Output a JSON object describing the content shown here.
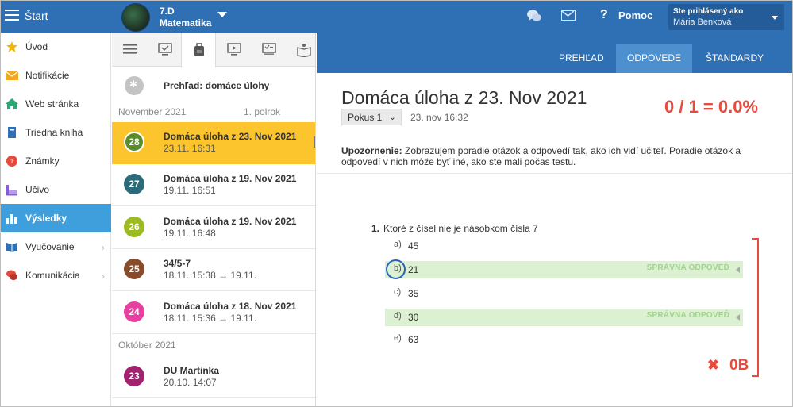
{
  "topbar": {
    "start_label": "Štart",
    "class_name": "7.D",
    "class_subject": "Matematika",
    "help_label": "Pomoc",
    "user_label": "Ste prihlásený ako",
    "user_name": "Mária Benková",
    "color": "#2f6fb3"
  },
  "nav": {
    "items": [
      {
        "label": "Úvod",
        "icon": "star-icon",
        "color": "#f2b705"
      },
      {
        "label": "Notifikácie",
        "icon": "envelope-icon",
        "color": "#f5a623"
      },
      {
        "label": "Web stránka",
        "icon": "house-icon",
        "color": "#2aa876"
      },
      {
        "label": "Triedna kniha",
        "icon": "book-icon",
        "color": "#2f6fb3"
      },
      {
        "label": "Známky",
        "icon": "grade-icon",
        "color": "#e84a3c"
      },
      {
        "label": "Učivo",
        "icon": "monitor-icon",
        "color": "#8a5bd6"
      },
      {
        "label": "Výsledky",
        "icon": "bar-chart-icon",
        "color": "#ffffff"
      },
      {
        "label": "Vyučovanie",
        "icon": "open-book-icon",
        "color": "#2f6fb3"
      },
      {
        "label": "Komunikácia",
        "icon": "chat-bubbles-icon",
        "color": "#e84a3c"
      }
    ],
    "active_index": 6
  },
  "list": {
    "overview_label": "Prehľad: domáce úlohy",
    "month_1": "November 2021",
    "term_1": "1. polrok",
    "month_2": "Október 2021",
    "rows": [
      {
        "num": "28",
        "title": "Domáca úloha z 23. Nov 2021",
        "date": "23.11. 16:31",
        "color": "#5a8e2b"
      },
      {
        "num": "27",
        "title": "Domáca úloha z 19. Nov 2021",
        "date": "19.11. 16:51",
        "color": "#2b6a7a"
      },
      {
        "num": "26",
        "title": "Domáca úloha z 19. Nov 2021",
        "date": "19.11. 16:48",
        "color": "#9cbb1f"
      },
      {
        "num": "25",
        "title": "34/5-7",
        "date": "18.11. 15:38 → 19.11.",
        "color": "#8a4b2a"
      },
      {
        "num": "24",
        "title": "Domáca úloha z 18. Nov 2021",
        "date": "18.11. 15:36 → 19.11.",
        "color": "#e83fa0"
      },
      {
        "num": "23",
        "title": "DU Martinka",
        "date": "20.10. 14:07",
        "color": "#a1226f"
      }
    ],
    "selected_color": "#fcc42d"
  },
  "detail": {
    "tabs": [
      "PREHĽAD",
      "ODPOVEDE",
      "ŠTANDARDY"
    ],
    "active_tab": 1,
    "title": "Domáca úloha z 23. Nov 2021",
    "attempt_label": "Pokus 1",
    "attempt_time": "23. nov 16:32",
    "score": "0 / 1 = 0.0%",
    "warning_bold": "Upozornenie:",
    "warning_text": " Zobrazujem poradie otázok a odpovedí tak, ako ich vidí učiteľ. Poradie otázok a odpovedí v nich môže byť iné, ako ste mali počas testu.",
    "question_number": "1.",
    "question_text": "Ktoré z čísel nie je násobkom čísla 7",
    "options": [
      {
        "letter": "a)",
        "value": "45",
        "correct": false,
        "chosen": false
      },
      {
        "letter": "b)",
        "value": "21",
        "correct": true,
        "chosen": true
      },
      {
        "letter": "c)",
        "value": "35",
        "correct": false,
        "chosen": false
      },
      {
        "letter": "d)",
        "value": "30",
        "correct": true,
        "chosen": false
      },
      {
        "letter": "e)",
        "value": "63",
        "correct": false,
        "chosen": false
      }
    ],
    "correct_label": "SPRÁVNA ODPOVEĎ",
    "question_score": "0B",
    "score_color": "#e84a3c",
    "correct_bg": "#dcf0d2"
  }
}
